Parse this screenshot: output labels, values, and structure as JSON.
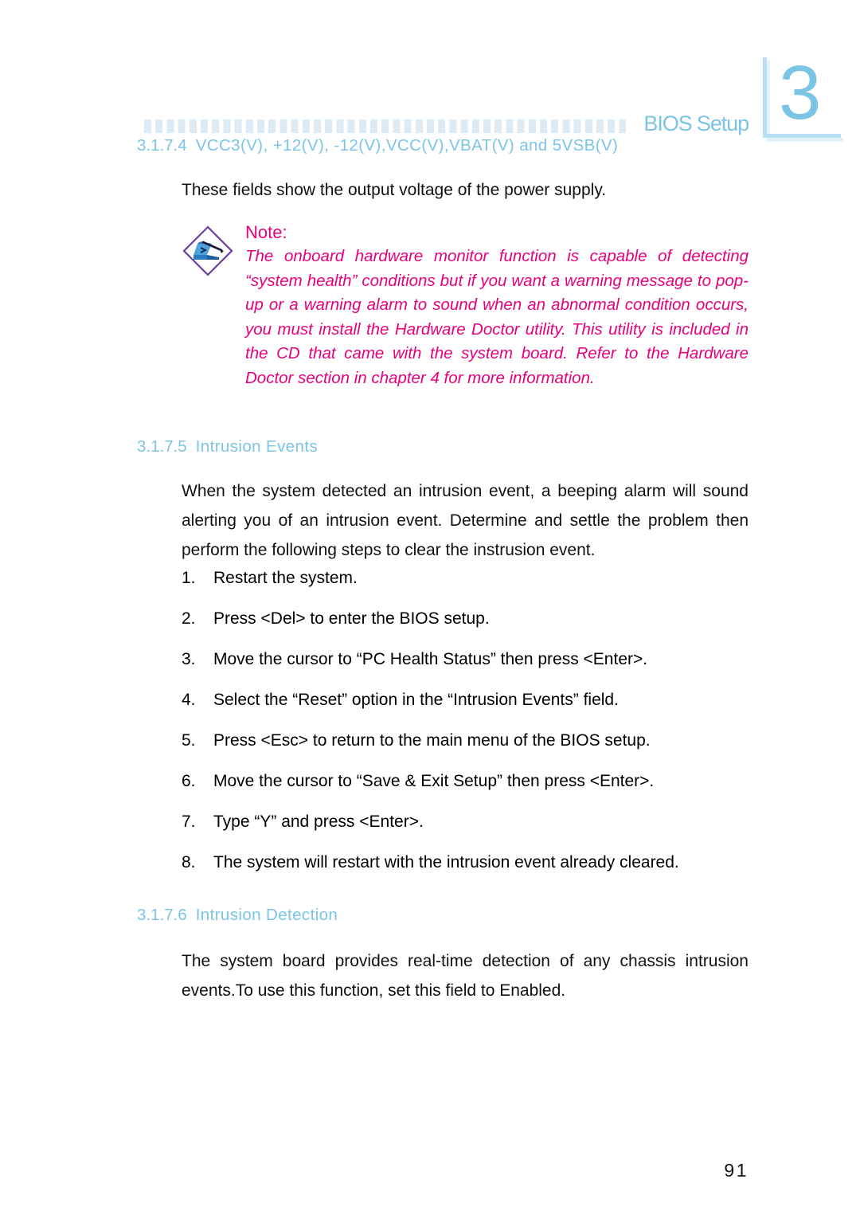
{
  "header": {
    "title": "BIOS Setup",
    "chapter_number": "3",
    "rule_icon": "dotted-rule"
  },
  "sections": [
    {
      "number": "3.1.7.4",
      "title": "VCC3(V), +12(V), -12(V),VCC(V),VBAT(V) and 5VSB(V)",
      "body": "These fields show the output voltage of the power supply."
    },
    {
      "number": "3.1.7.5",
      "title": "Intrusion Events",
      "body": "When the system detected an intrusion event, a beeping alarm will sound alerting you of an intrusion event. Determine and settle the problem then perform the following steps to clear the instrusion event."
    },
    {
      "number": "3.1.7.6",
      "title": "Intrusion Detection",
      "body": "The system board provides real-time detection of any chassis intrusion events.To use this function, set this field to Enabled."
    }
  ],
  "note": {
    "icon": "note-diamond-icon",
    "title": "Note:",
    "text": "The onboard hardware monitor function is capable of detecting “system health” conditions but if you want a warning message to pop-up or a warning alarm to sound when an abnormal condition occurs, you must install the Hardware Doctor utility. This utility is included in the CD that came with the system board. Refer to the Hardware Doctor section in chapter 4 for more information."
  },
  "steps": [
    {
      "num": "1.",
      "text": "Restart the system."
    },
    {
      "num": "2.",
      "text": "Press <Del> to enter the BIOS setup."
    },
    {
      "num": "3.",
      "text": "Move the cursor to “PC Health Status” then press <Enter>."
    },
    {
      "num": "4.",
      "text": "Select the “Reset” option in the “Intrusion Events” field."
    },
    {
      "num": "5.",
      "text": "Press <Esc> to return to the main menu of the BIOS setup."
    },
    {
      "num": "6.",
      "text": "Move the cursor to “Save & Exit Setup” then press <Enter>."
    },
    {
      "num": "7.",
      "text": "Type “Y” and press <Enter>."
    },
    {
      "num": "8.",
      "text": "The system will restart with the intrusion event already cleared."
    }
  ],
  "footer": {
    "page_number": "91"
  },
  "colors": {
    "heading_blue": "#7cc4e6",
    "note_magenta": "#e6007e",
    "body_black": "#111111",
    "rule_light_blue": "#dceaf6",
    "bracket_blue": "#b9dff2",
    "icon_diamond_purple": "#6b3fa0",
    "icon_scroll_blue": "#2b7bc4"
  }
}
